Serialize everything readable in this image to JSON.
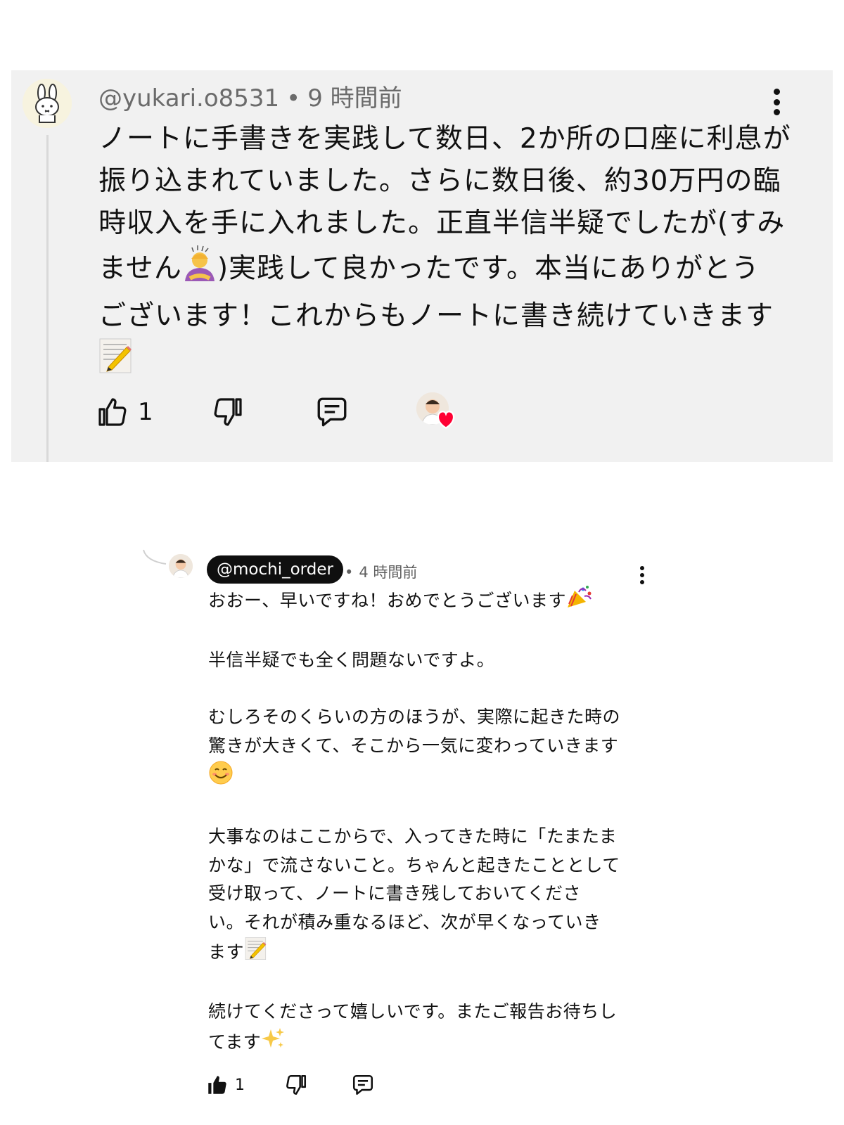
{
  "comment": {
    "author": "@yukari.o8531",
    "separator": "•",
    "time": "9 時間前",
    "text": "ノートに手書きを実践して数日、2か所の口座に利息が\n振り込まれていました。さらに数日後、約30万円の臨\n時収入を手に入れました。正直半信半疑でしたが(すみ\nません",
    "text_after_emoji": ")実践して良かったです。本当にありがとう\nございます！これからもノートに書き続けていきます\n",
    "emoji_mid": "person-gesturing-ok-emoji",
    "emoji_end": "memo-emoji",
    "like_count": "1",
    "icons": [
      "avatar-rabbit",
      "thumbs-up-icon",
      "thumbs-down-icon",
      "reply-icon",
      "creator-heart-icon",
      "more-vert-icon"
    ]
  },
  "reply": {
    "author": "@mochi_order",
    "separator": "•",
    "time": "4 時間前",
    "p1": "おおー、早いですね！おめでとうございます",
    "p2": "半信半疑でも全く問題ないですよ。",
    "p3": "むしろそのくらいの方のほうが、実際に起きた時の\n驚きが大きくて、そこから一気に変わっていきます\n",
    "p4": "大事なのはここからで、入ってきた時に「たまたま\nかな」で流さないこと。ちゃんと起きたこととして\n受け取って、ノートに書き残しておいてくださ\nい。それが積み重なるほど、次が早くなっていき\nます",
    "p5": "続けてくださって嬉しいです。またご報告お待ちし\nてます",
    "emojis": [
      "party-popper-emoji",
      "smiling-face-emoji",
      "memo-emoji",
      "sparkles-emoji"
    ],
    "like_count": "1",
    "colors": {
      "pill_bg": "#0f0f0f",
      "pill_text": "#ffffff",
      "card_bg": "#f1f1f1",
      "heart": "#ff0033"
    }
  }
}
